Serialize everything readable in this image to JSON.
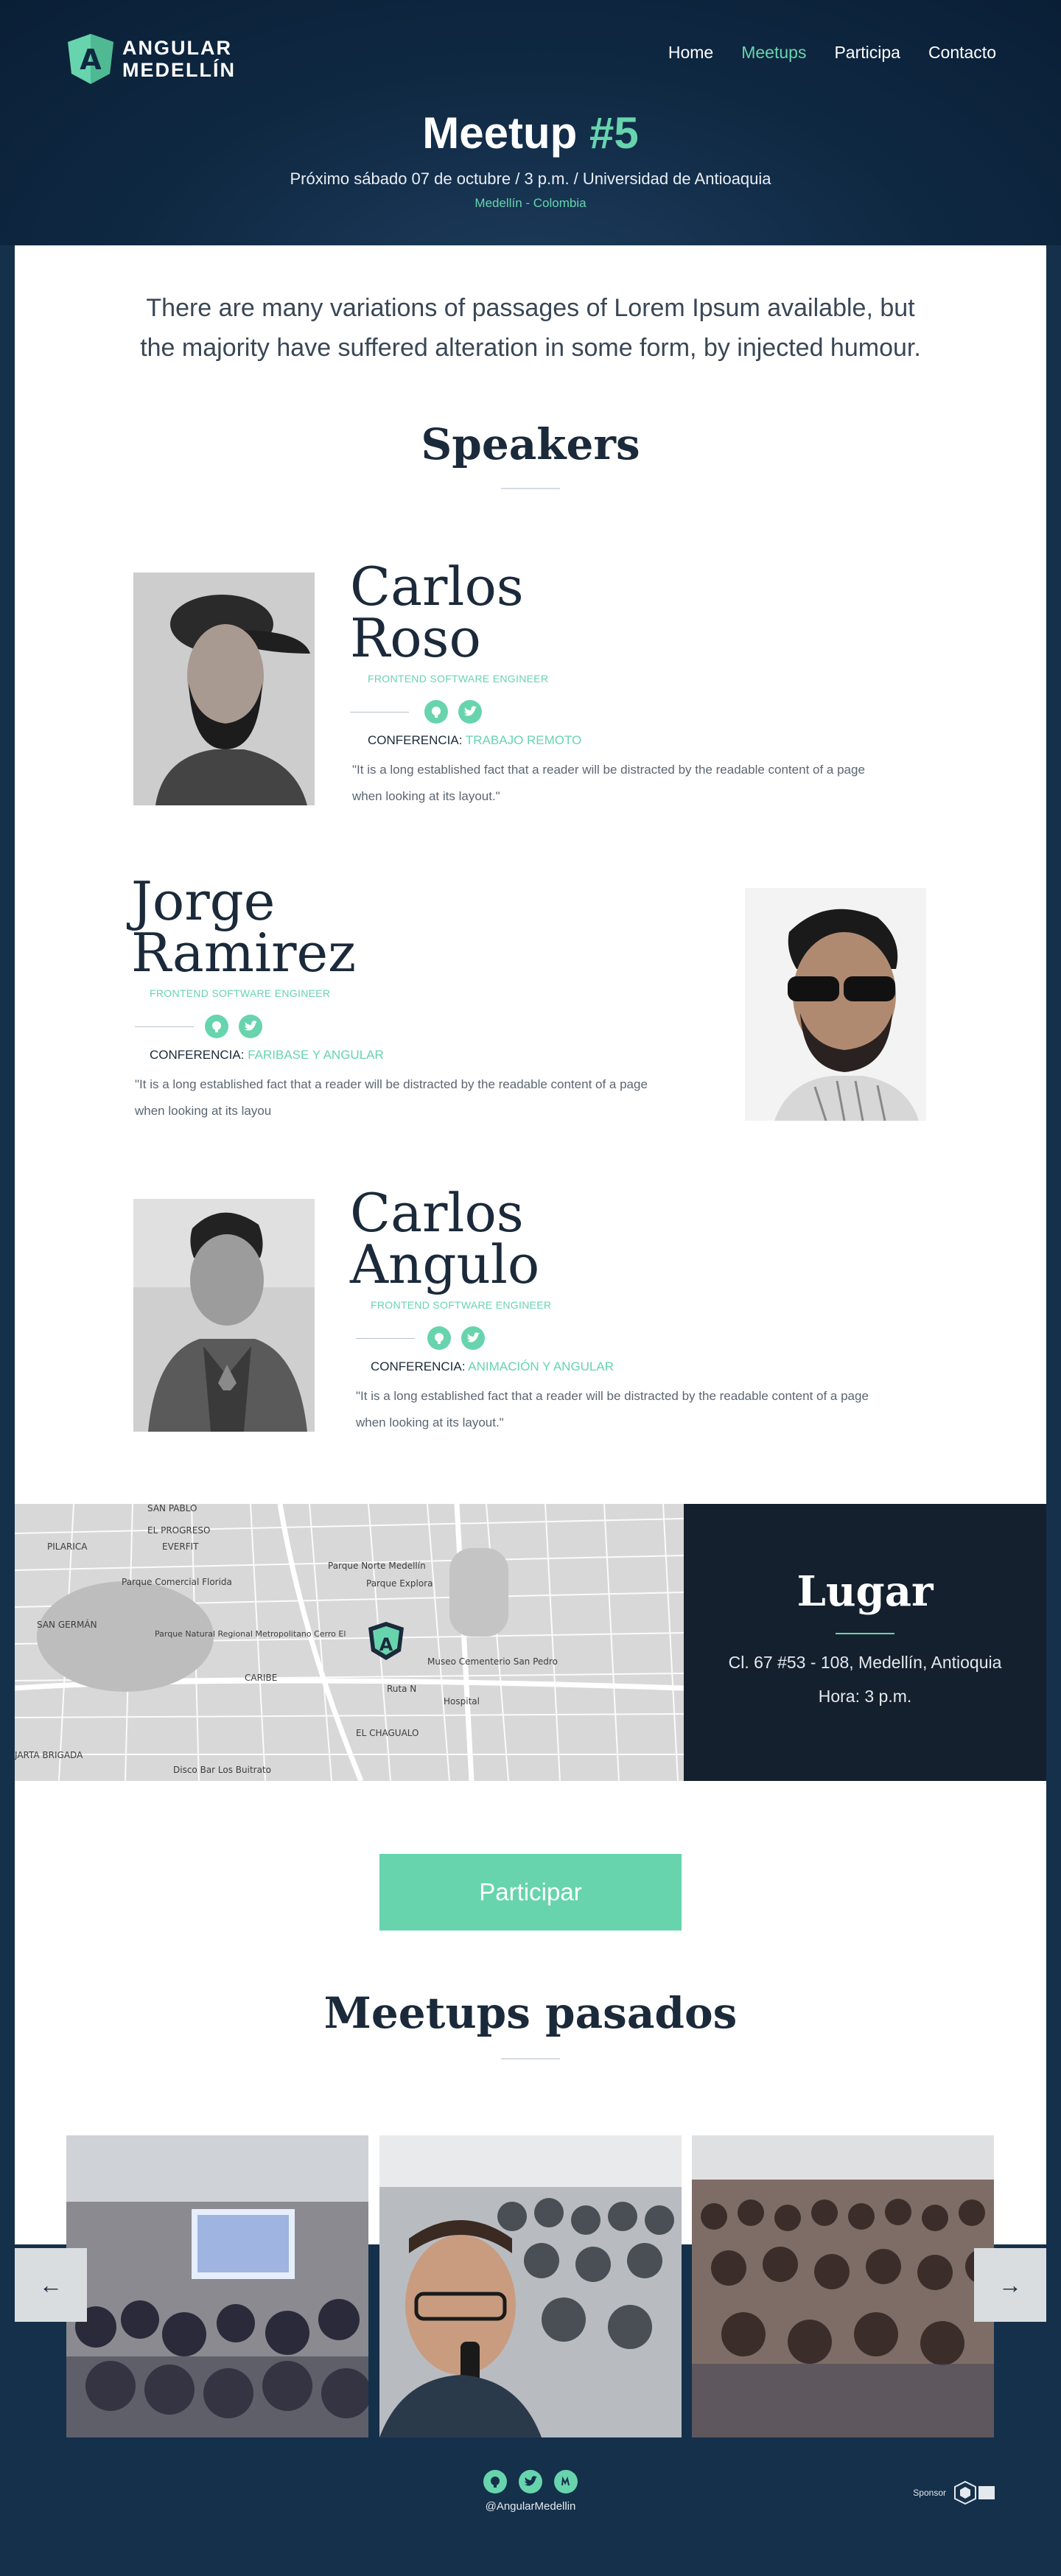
{
  "brand": {
    "line1": "ANGULAR",
    "line2": "MEDELLÍN"
  },
  "nav": {
    "items": [
      "Home",
      "Meetups",
      "Participa",
      "Contacto"
    ],
    "active": "Meetups"
  },
  "hero": {
    "title": "Meetup",
    "number": "#5",
    "subtitle": "Próximo sábado 07 de octubre / 3 p.m. / Universidad de Antioaquia",
    "location": "Medellín - Colombia"
  },
  "intro": "There are many variations of passages of Lorem Ipsum available, but the majority have suffered alteration in some form, by injected humour.",
  "speakers_section": {
    "title": "Speakers"
  },
  "speakers": [
    {
      "first": "Carlos",
      "last": "Roso",
      "role": "FRONTEND SOFTWARE ENGINEER",
      "conf_label": "CONFERENCIA:",
      "talk": "TRABAJO REMOTO",
      "quote": "\"It is a long established fact that a reader will be distracted by the readable content of a page when looking at its layout.\""
    },
    {
      "first": "Jorge",
      "last": "Ramirez",
      "role": "FRONTEND SOFTWARE ENGINEER",
      "conf_label": "CONFERENCIA:",
      "talk": "FARIBASE Y ANGULAR",
      "quote": "\"It is a long established fact that a reader will be distracted by the readable content of a page when looking at its layou"
    },
    {
      "first": "Carlos",
      "last": "Angulo",
      "role": "FRONTEND SOFTWARE ENGINEER",
      "conf_label": "CONFERENCIA:",
      "talk": "ANIMACIÓN Y ANGULAR",
      "quote": "\"It is a long established fact that a reader will be distracted by the readable content of a page when looking at its layout.\""
    }
  ],
  "map_labels": {
    "el_progreso": "EL PROGRESO",
    "everfit": "EVERFIT",
    "pilarica": "PILARICA",
    "san_german": "SAN GERMÁN",
    "parque_comercial": "Parque Comercial Florida",
    "parque_natural": "Parque Natural Regional Metropolitano Cerro El",
    "norte_medellin": "Parque Norte Medellín",
    "parque_explora": "Parque Explora",
    "museo": "Museo Cementerio San Pedro",
    "caribe": "CARIBE",
    "el_chagualo": "EL CHAGUALO",
    "ruta_n": "Ruta N",
    "hospital": "Hospital",
    "brigada": "JARTA BRIGADA",
    "disco_bar": "Disco Bar Los Buitrato",
    "san_pablo": "SAN PABLO"
  },
  "lugar": {
    "title": "Lugar",
    "address": "Cl. 67 #53 - 108, Medellín, Antioquia",
    "time": "Hora: 3 p.m."
  },
  "cta": {
    "label": "Participar"
  },
  "past": {
    "title": "Meetups pasados",
    "prev": "←",
    "next": "→"
  },
  "footer": {
    "icons": [
      "github-icon",
      "twitter-icon",
      "meetup-icon"
    ],
    "handle": "@AngularMedellin",
    "sponsor_label": "Sponsor"
  },
  "colors": {
    "accent": "#67d4ae",
    "navy": "#15304b",
    "dark": "#15202e"
  }
}
